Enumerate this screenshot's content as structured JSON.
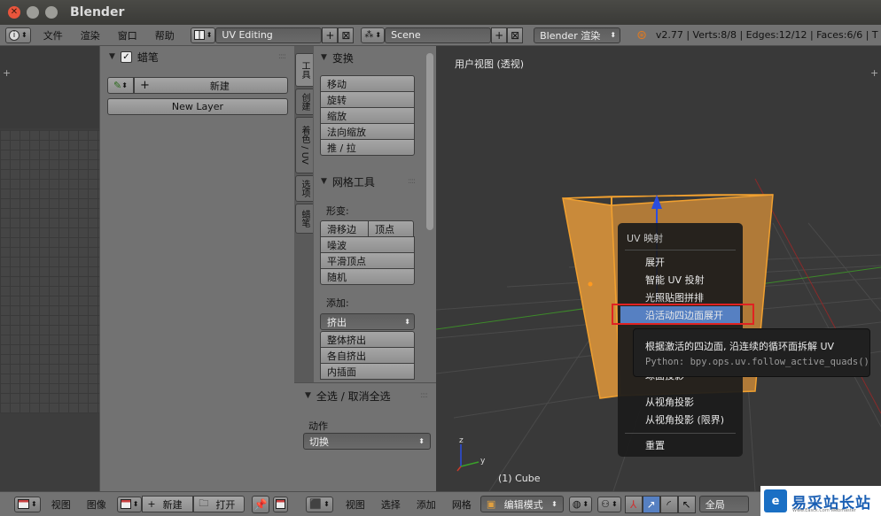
{
  "window": {
    "title": "Blender"
  },
  "info_header": {
    "menus": [
      "文件",
      "渲染",
      "窗口",
      "帮助"
    ],
    "layout": "UV Editing",
    "scene": "Scene",
    "engine": "Blender 渲染",
    "stats": "v2.77 | Verts:8/8 | Edges:12/12 | Faces:6/6 | T"
  },
  "grease_pencil": {
    "header": "蜡笔",
    "new_label": "新建",
    "new_layer_label": "New Layer"
  },
  "tool_tabs": [
    "工具",
    "创建",
    "着色 / UV",
    "选项",
    "蜡笔"
  ],
  "tools": {
    "transform_header": "变换",
    "transform_items": [
      "移动",
      "旋转",
      "缩放",
      "法向缩放",
      "推 / 拉"
    ],
    "mesh_header": "网格工具",
    "deform_label": "形变:",
    "slide_edge": "滑移边",
    "vertex": "顶点",
    "deform_items": [
      "噪波",
      "平滑顶点",
      "随机"
    ],
    "add_label": "添加:",
    "extrude": "挤出",
    "add_items": [
      "整体挤出",
      "各自挤出",
      "内插面"
    ]
  },
  "redo_panel": {
    "header": "全选 / 取消全选",
    "action_label": "动作",
    "action_value": "切换"
  },
  "viewport": {
    "label": "用户视图 (透视)",
    "object_label": "(1) Cube"
  },
  "uv_menu": {
    "title": "UV 映射",
    "items": [
      "展开",
      "智能 UV 投射",
      "光照贴图拼排",
      "沿活动四边面展开"
    ],
    "partial_item": "球面投影",
    "items2": [
      "从视角投影",
      "从视角投影 (限界)"
    ],
    "reset": "重置"
  },
  "tooltip": {
    "title": "根据激活的四边面, 沿连续的循环面拆解 UV",
    "python": "Python: bpy.ops.uv.follow_active_quads()"
  },
  "bottom_left": {
    "menus": [
      "视图",
      "图像"
    ],
    "new_label": "新建",
    "open_label": "打开"
  },
  "bottom_right": {
    "menus": [
      "视图",
      "选择",
      "添加",
      "网格"
    ],
    "mode": "编辑模式",
    "orientation": "全局"
  },
  "watermark": {
    "text": "易采站长站",
    "sub": "Www.Easck.Com Webmaster"
  },
  "colors": {
    "selection": "#5680c2",
    "mesh": "#f0a030",
    "highlight_frame": "#e02222"
  }
}
